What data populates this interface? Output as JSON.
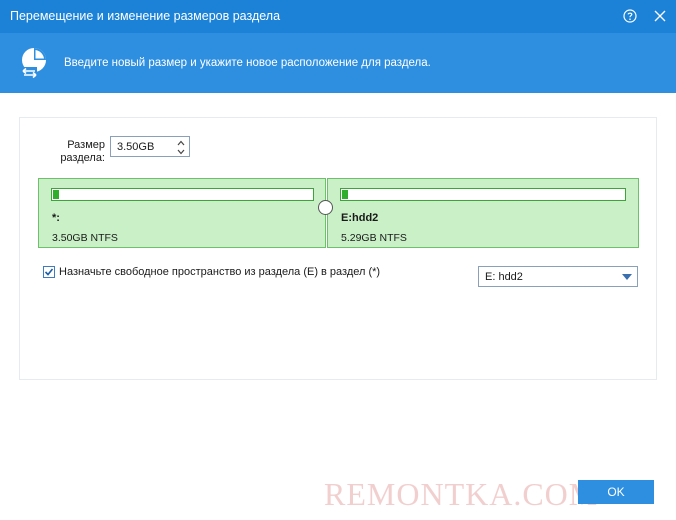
{
  "window": {
    "title": "Перемещение и изменение размеров раздела",
    "help_icon": "help-icon",
    "close_icon": "close-icon"
  },
  "banner": {
    "icon": "partition-move-icon",
    "text": "Введите новый размер и укажите новое расположение для раздела."
  },
  "size": {
    "label": "Размер\nраздела:",
    "value": "3.50GB"
  },
  "partitions": [
    {
      "name": "*:",
      "info": "3.50GB NTFS",
      "used_fraction": 0.02
    },
    {
      "name": "E:hdd2",
      "info": "5.29GB NTFS",
      "used_fraction": 0.02
    }
  ],
  "allocate": {
    "checked": true,
    "label": "Назначьте свободное пространство из раздела (E) в раздел (*)",
    "select_value": "E: hdd2"
  },
  "watermark": "REMONTKA.COM",
  "ok_label": "OK",
  "colors": {
    "titlebar": "#1b82d7",
    "banner": "#2e8fe0",
    "partition_bg": "#c9f0c6",
    "partition_border": "#6ec06a",
    "fill": "#2fae2b"
  }
}
